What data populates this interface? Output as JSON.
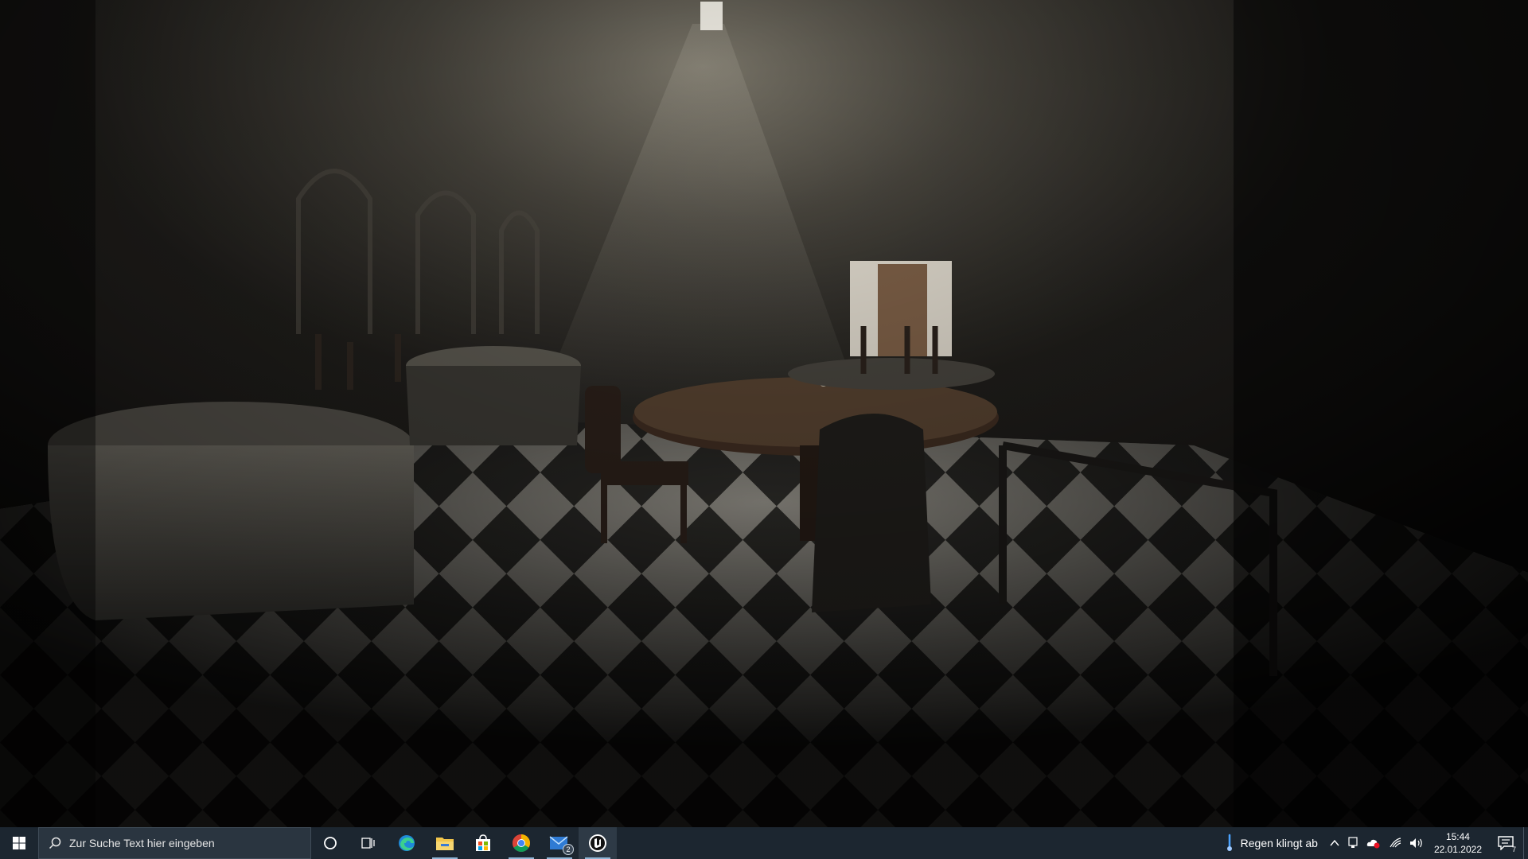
{
  "taskbar": {
    "search_placeholder": "Zur Suche Text hier eingeben",
    "pinned_apps": [
      {
        "name": "Microsoft Edge",
        "icon": "edge-icon"
      },
      {
        "name": "Datei-Explorer",
        "icon": "file-explorer-icon"
      },
      {
        "name": "Microsoft Store",
        "icon": "store-icon"
      },
      {
        "name": "Google Chrome",
        "icon": "chrome-icon"
      },
      {
        "name": "Mail",
        "icon": "mail-icon",
        "badge": "2"
      },
      {
        "name": "Unreal Engine",
        "icon": "unreal-engine-icon"
      }
    ],
    "weather_text": "Regen klingt ab",
    "clock": {
      "time": "15:44",
      "date": "22.01.2022"
    },
    "notification_count": "7",
    "colors": {
      "background": "#1c2630",
      "accent": "#8fb5d6"
    }
  }
}
